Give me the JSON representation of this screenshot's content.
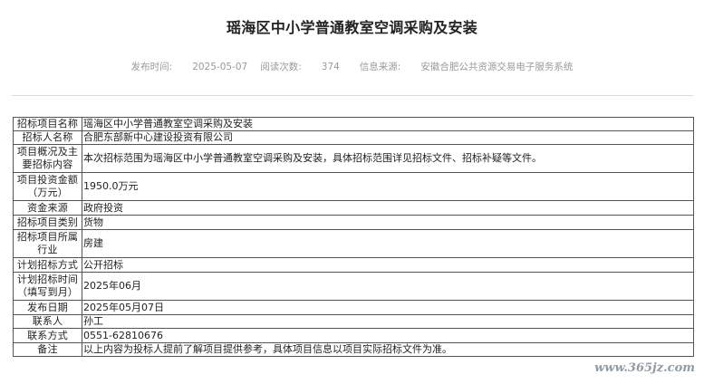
{
  "article": {
    "title": "瑶海区中小学普通教室空调采购及安装",
    "meta": {
      "publish_label": "发布时间:",
      "publish_date": "2025-05-07",
      "views_label": "阅读次数:",
      "views": "374",
      "source_label": "信息来源:",
      "source": "安徽合肥公共资源交易电子服务系统"
    }
  },
  "table": {
    "rows": [
      {
        "key": "招标项目名称",
        "value": "瑶海区中小学普通教室空调采购及安装"
      },
      {
        "key": "招标人名称",
        "value": "合肥东部新中心建设投资有限公司"
      },
      {
        "key": "项目概况及主要招标内容",
        "value": "本次招标范围为瑶海区中小学普通教室空调采购及安装，具体招标范围详见招标文件、招标补疑等文件。"
      },
      {
        "key": "项目投资金额（万元）",
        "value": "1950.0万元"
      },
      {
        "key": "资金来源",
        "value": "政府投资"
      },
      {
        "key": "招标项目类别",
        "value": "货物"
      },
      {
        "key": "招标项目所属行业",
        "value": "房建"
      },
      {
        "key": "计划招标方式",
        "value": "公开招标"
      },
      {
        "key": "计划招标时间（填写到月）",
        "value": "2025年06月"
      },
      {
        "key": "发布日期",
        "value": "2025年05月07日"
      },
      {
        "key": "联系人",
        "value": "孙工"
      },
      {
        "key": "联系方式",
        "value": "0551-62810676"
      },
      {
        "key": "备注",
        "value": "以上内容为投标人提前了解项目提供参考，具体项目信息以项目实际招标文件为准。"
      }
    ]
  },
  "watermark": {
    "text": "www.365jz.com"
  }
}
